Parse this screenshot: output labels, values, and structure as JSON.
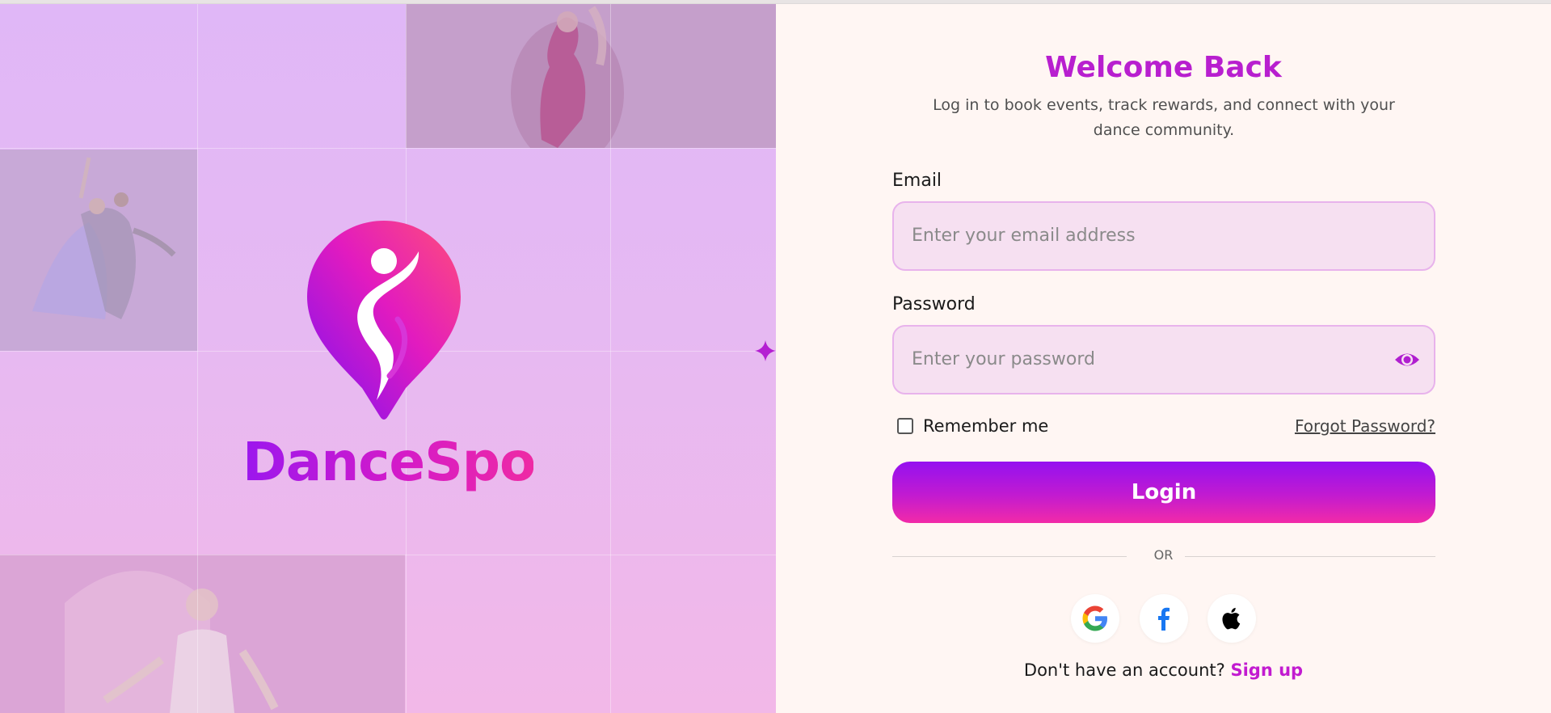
{
  "brand": {
    "name": "DanceSpot",
    "gradient_start": "#9b17ee",
    "gradient_end": "#ee2aa4"
  },
  "hero": {
    "sparkle_icon": "sparkle-icon",
    "logo_icon": "dancer-pin-logo"
  },
  "login": {
    "title": "Welcome Back",
    "subtitle": "Log in to book events, track rewards, and connect with your dance community.",
    "email": {
      "label": "Email",
      "placeholder": "Enter your email address",
      "value": ""
    },
    "password": {
      "label": "Password",
      "placeholder": "Enter your password",
      "value": "",
      "toggle_icon": "eye-icon"
    },
    "remember_me": {
      "label": "Remember me",
      "checked": false
    },
    "forgot_password": "Forgot Password?",
    "submit": "Login",
    "divider": "OR",
    "social": [
      {
        "provider": "Google",
        "icon": "google-icon"
      },
      {
        "provider": "Facebook",
        "icon": "facebook-icon"
      },
      {
        "provider": "Apple",
        "icon": "apple-icon"
      }
    ],
    "signup_prompt": "Don't have an account?",
    "signup_link": "Sign up"
  },
  "colors": {
    "accent": "#b81fcf",
    "panel_bg": "#fff6f3",
    "input_bg": "#f6e0f1",
    "input_border": "#e8b3ec"
  }
}
